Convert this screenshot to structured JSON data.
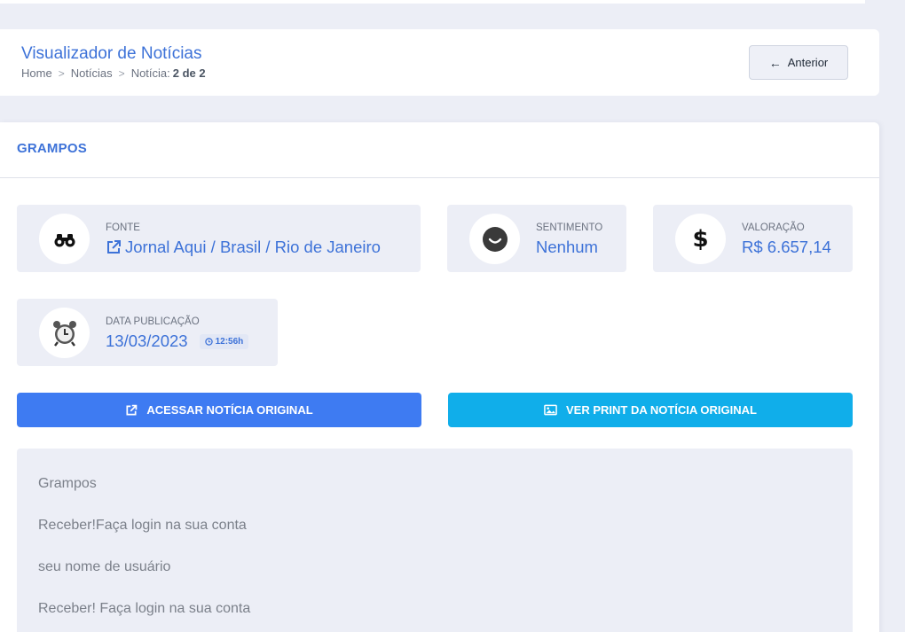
{
  "header": {
    "title": "Visualizador de Notícias",
    "breadcrumb": {
      "home": "Home",
      "section": "Notícias",
      "current_prefix": "Notícia:",
      "current_value": "2 de 2"
    },
    "prev_button": "Anterior"
  },
  "main": {
    "title": "GRAMPOS",
    "fonte": {
      "label": "FONTE",
      "value": "Jornal Aqui / Brasil / Rio de Janeiro",
      "icon": "binoculars-icon"
    },
    "sentimento": {
      "label": "SENTIMENTO",
      "value": "Nenhum",
      "icon": "neutral-face-icon"
    },
    "valoracao": {
      "label": "VALORAÇÃO",
      "value": "R$ 6.657,14",
      "icon": "dollar-icon"
    },
    "data_publicacao": {
      "label": "DATA PUBLICAÇÃO",
      "value": "13/03/2023",
      "time": "12:56h",
      "icon": "alarm-clock-icon"
    },
    "buttons": {
      "original": "ACESSAR NOTÍCIA ORIGINAL",
      "print": "VER PRINT DA NOTÍCIA ORIGINAL"
    },
    "content": [
      "Grampos",
      "Receber!Faça login na sua conta",
      "seu nome de usuário",
      "Receber! Faça login na sua conta"
    ]
  },
  "colors": {
    "accent": "#3d72d8",
    "primary_button": "#3e7bf2",
    "info_button": "#10aeea",
    "background": "#eceef6"
  }
}
